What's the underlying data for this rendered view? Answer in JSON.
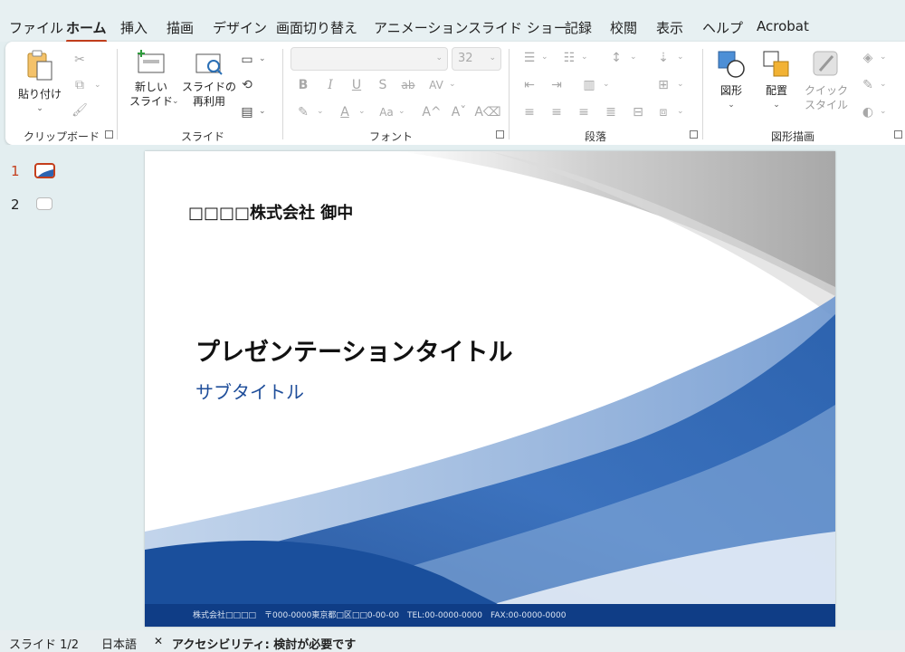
{
  "menu": {
    "tabs": [
      "ファイル",
      "ホーム",
      "挿入",
      "描画",
      "デザイン",
      "画面切り替え",
      "アニメーション",
      "スライド ショー",
      "記録",
      "校閲",
      "表示",
      "ヘルプ",
      "Acrobat"
    ],
    "active": "ホーム"
  },
  "ribbon": {
    "clipboard": {
      "paste_label": "貼り付け",
      "group_label": "クリップボード"
    },
    "slides": {
      "new_slide_label_1": "新しい",
      "new_slide_label_2": "スライド",
      "reuse_label_1": "スライドの",
      "reuse_label_2": "再利用",
      "group_label": "スライド"
    },
    "font": {
      "font_name": "",
      "font_size": "32",
      "group_label": "フォント"
    },
    "paragraph": {
      "group_label": "段落"
    },
    "drawing": {
      "shapes_label": "図形",
      "arrange_label": "配置",
      "quick_styles_label_1": "クイック",
      "quick_styles_label_2": "スタイル",
      "group_label": "図形描画"
    }
  },
  "thumbnails": [
    {
      "number": "1",
      "selected": true
    },
    {
      "number": "2",
      "selected": false
    }
  ],
  "slide": {
    "company": "□□□□株式会社 御中",
    "title": "プレゼンテーションタイトル",
    "subtitle": "サブタイトル",
    "footer": "株式会社□□□□　〒000-0000東京都□区□□0-00-00　TEL:00-0000-0000　FAX:00-0000-0000"
  },
  "status": {
    "slide_indicator": "スライド 1/2",
    "language": "日本語",
    "accessibility": "アクセシビリティ: 検討が必要です"
  },
  "colors": {
    "accent": "#c43e1c",
    "subtitle": "#1f4e9a",
    "wave_dark": "#1a4f9c",
    "wave_light": "#8fb2dc"
  }
}
